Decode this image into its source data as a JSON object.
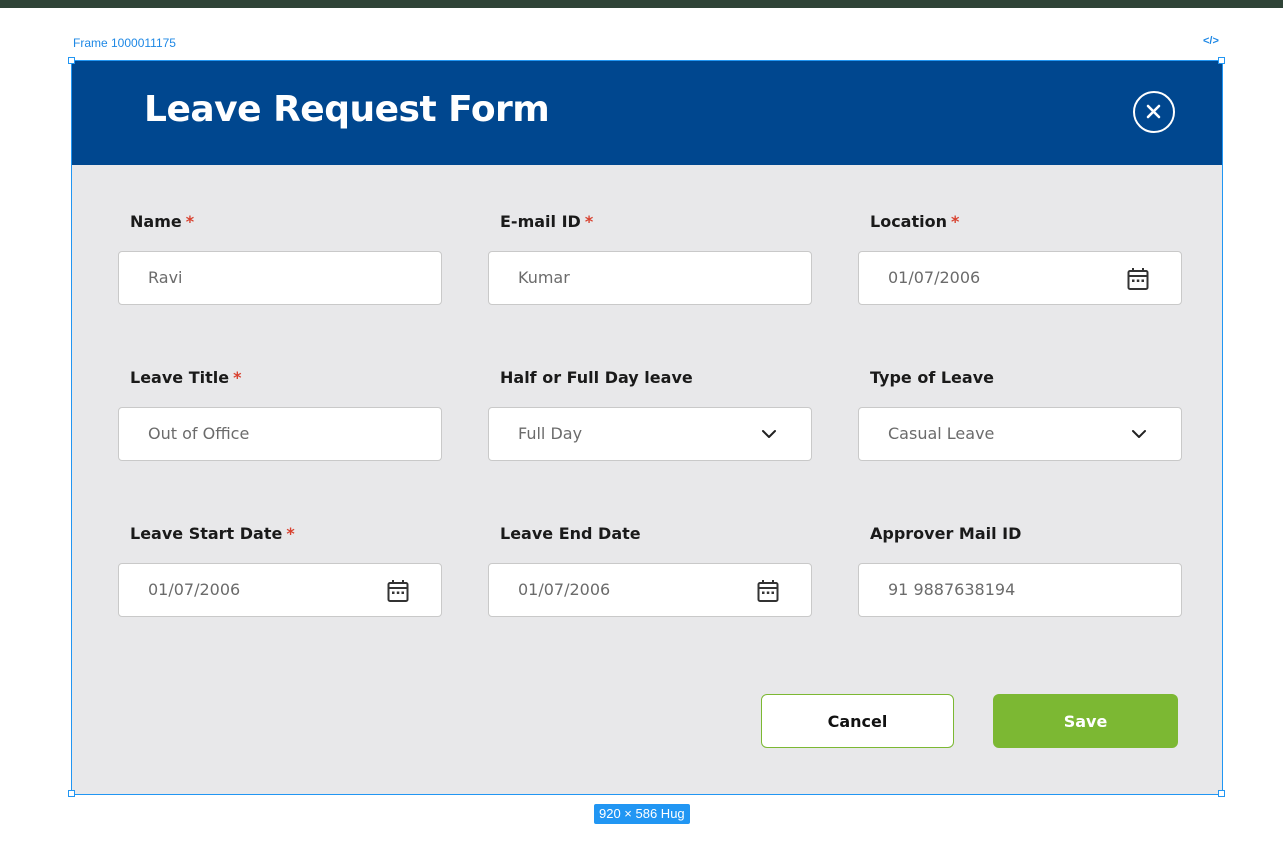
{
  "canvas": {
    "frame_label": "Frame 1000011175",
    "code_icon": "code-icon",
    "size_badge": "920 × 586 Hug",
    "accent_color": "#2196f3"
  },
  "form": {
    "title": "Leave Request Form",
    "header_color": "#00478f",
    "close_icon": "close-circle-icon",
    "required_marker": "*",
    "required_color": "#d8412f",
    "fields": [
      {
        "label": "Name",
        "required": true,
        "value": "Ravi",
        "icon": null
      },
      {
        "label": "E-mail ID",
        "required": true,
        "value": "Kumar",
        "icon": null
      },
      {
        "label": "Location",
        "required": true,
        "value": "01/07/2006",
        "icon": "calendar-icon"
      },
      {
        "label": "Leave Title",
        "required": true,
        "value": "Out of Office",
        "icon": null
      },
      {
        "label": "Half or Full Day leave",
        "required": false,
        "value": "Full Day",
        "icon": "chevron-down-icon"
      },
      {
        "label": "Type of Leave",
        "required": false,
        "value": "Casual Leave",
        "icon": "chevron-down-icon"
      },
      {
        "label": "Leave Start Date",
        "required": true,
        "value": "01/07/2006",
        "icon": "calendar-icon"
      },
      {
        "label": "Leave End Date",
        "required": false,
        "value": "01/07/2006",
        "icon": "calendar-icon"
      },
      {
        "label": "Approver Mail ID",
        "required": false,
        "value": "91 9887638194",
        "icon": null
      }
    ],
    "buttons": {
      "cancel_label": "Cancel",
      "save_label": "Save",
      "save_color": "#7cb833"
    }
  }
}
